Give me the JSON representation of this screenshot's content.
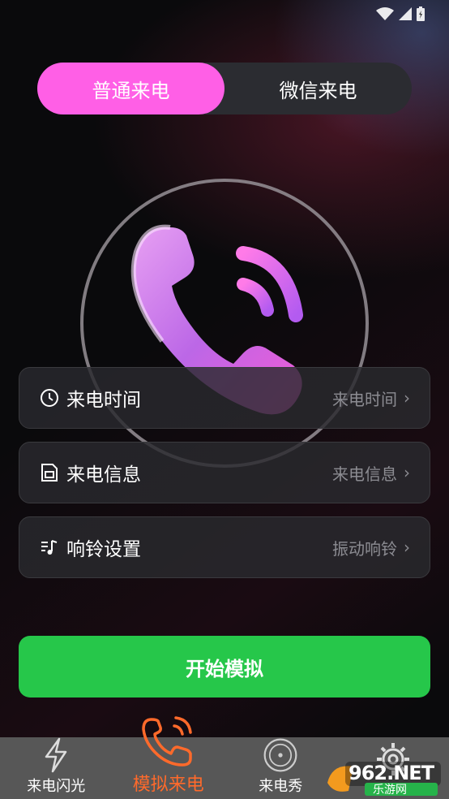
{
  "tabs": [
    {
      "label": "普通来电",
      "active": true
    },
    {
      "label": "微信来电",
      "active": false
    }
  ],
  "settings": [
    {
      "label": "来电时间",
      "value": "来电时间",
      "icon": "clock-icon"
    },
    {
      "label": "来电信息",
      "value": "来电信息",
      "icon": "sim-card-icon"
    },
    {
      "label": "响铃设置",
      "value": "振动响铃",
      "icon": "music-note-icon"
    }
  ],
  "chevron": "›",
  "start_button": "开始模拟",
  "nav": [
    {
      "label": "来电闪光",
      "icon": "lightning-icon",
      "active": false
    },
    {
      "label": "模拟来电",
      "icon": "phone-ringing-icon",
      "active": true
    },
    {
      "label": "来电秀",
      "icon": "badge-icon",
      "active": false
    },
    {
      "label": "",
      "icon": "gear-icon",
      "active": false
    }
  ],
  "watermark": {
    "text": "962.NET",
    "sub": "乐游网"
  },
  "colors": {
    "accent_pink": "#ff5fe6",
    "start_green": "#26c74a",
    "nav_active": "#ff6a2b",
    "nav_bg": "#575757"
  }
}
